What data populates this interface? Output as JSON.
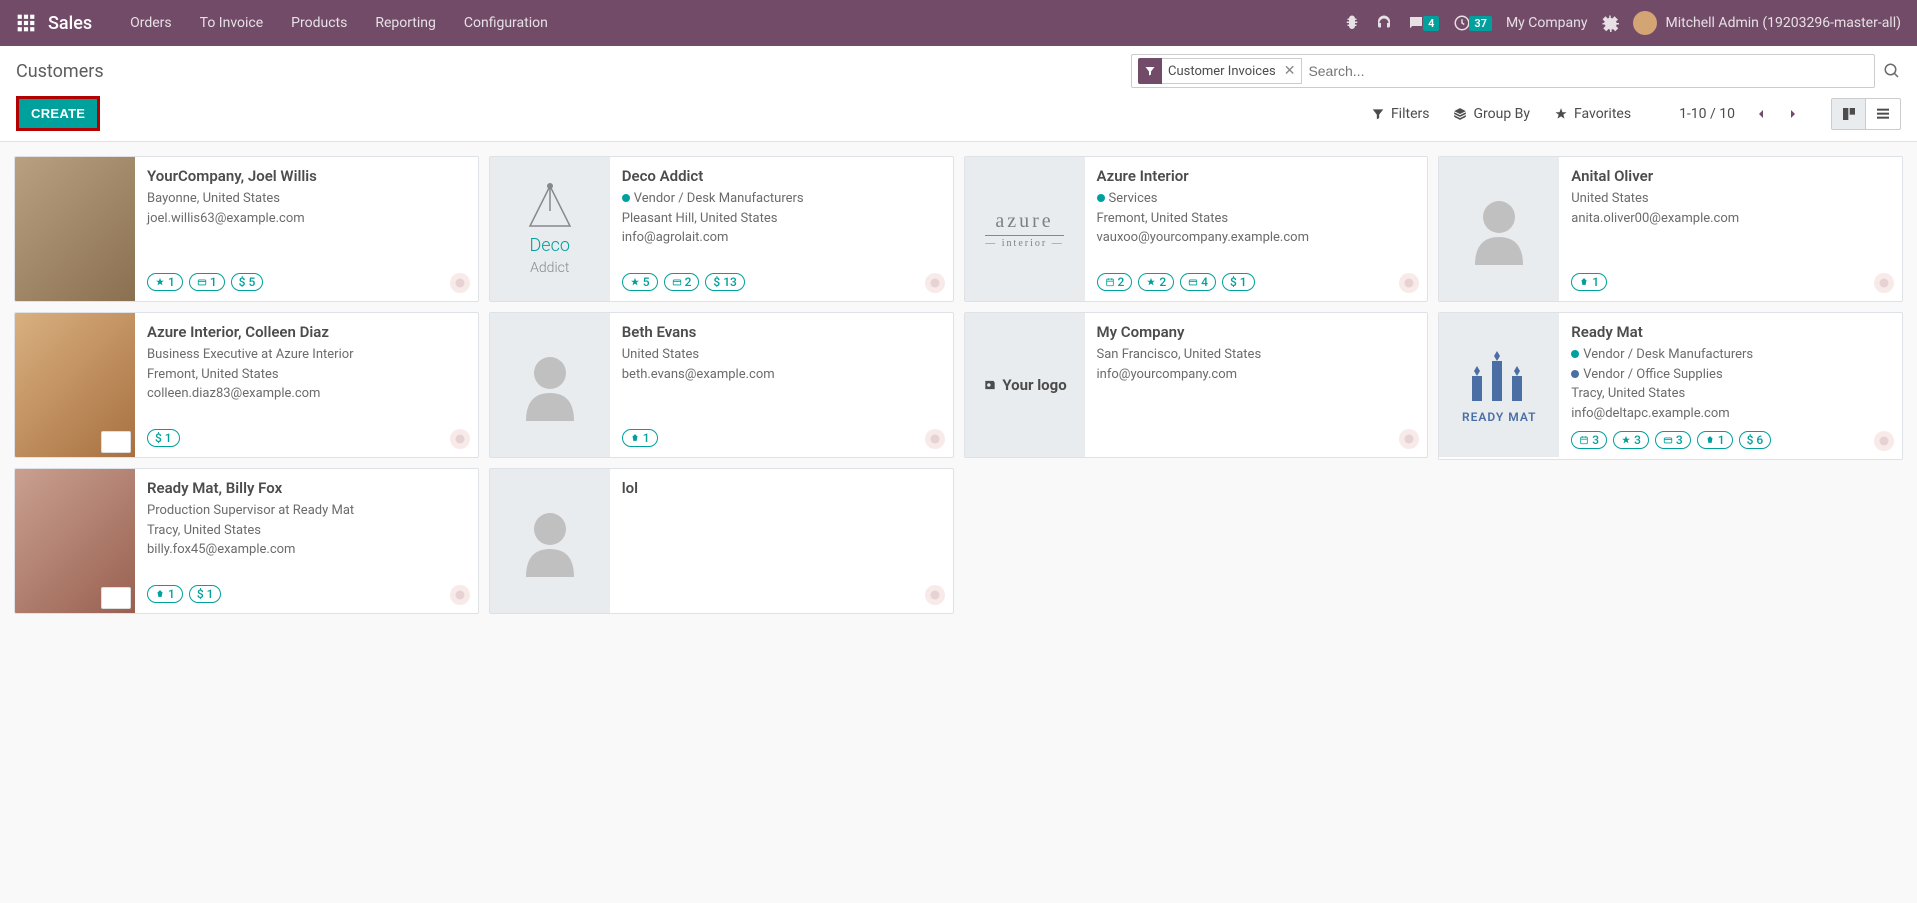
{
  "navbar": {
    "brand": "Sales",
    "links": [
      "Orders",
      "To Invoice",
      "Products",
      "Reporting",
      "Configuration"
    ],
    "messages_badge": "4",
    "activities_badge": "37",
    "company": "My Company",
    "user": "Mitchell Admin (19203296-master-all)"
  },
  "breadcrumb": "Customers",
  "create_label": "CREATE",
  "search": {
    "facet": "Customer Invoices",
    "placeholder": "Search..."
  },
  "toolbar": {
    "filters": "Filters",
    "groupby": "Group By",
    "favorites": "Favorites",
    "pager": "1-10 / 10"
  },
  "cards": {
    "c1": {
      "title": "YourCompany, Joel Willis",
      "l1": "Bayonne, United States",
      "l2": "joel.willis63@example.com",
      "p1": "1",
      "p2": "1",
      "p3": "$ 5"
    },
    "c2": {
      "title": "Deco Addict",
      "tag": "Vendor / Desk Manufacturers",
      "l1": "Pleasant Hill, United States",
      "l2": "info@agrolait.com",
      "p1": "5",
      "p2": "2",
      "p3": "$ 13"
    },
    "c3": {
      "title": "Azure Interior",
      "tag": "Services",
      "l1": "Fremont, United States",
      "l2": "vauxoo@yourcompany.example.com",
      "p1": "2",
      "p2": "2",
      "p3": "4",
      "p4": "$ 1"
    },
    "c4": {
      "title": "Anital Oliver",
      "l1": "United States",
      "l2": "anita.oliver00@example.com",
      "p1": "1"
    },
    "c5": {
      "title": "Azure Interior, Colleen Diaz",
      "sub": "Business Executive at Azure Interior",
      "l1": "Fremont, United States",
      "l2": "colleen.diaz83@example.com",
      "p1": "$ 1"
    },
    "c6": {
      "title": "Beth Evans",
      "l1": "United States",
      "l2": "beth.evans@example.com",
      "p1": "1"
    },
    "c7": {
      "title": "My Company",
      "l1": "San Francisco, United States",
      "l2": "info@yourcompany.com"
    },
    "c8": {
      "title": "Ready Mat",
      "tag1": "Vendor / Desk Manufacturers",
      "tag2": "Vendor / Office Supplies",
      "l1": "Tracy, United States",
      "l2": "info@deltapc.example.com",
      "p1": "3",
      "p2": "3",
      "p3": "3",
      "p4": "1",
      "p5": "$ 6"
    },
    "c9": {
      "title": "Ready Mat, Billy Fox",
      "sub": "Production Supervisor at Ready Mat",
      "l1": "Tracy, United States",
      "l2": "billy.fox45@example.com",
      "p1": "1",
      "p2": "$ 1"
    },
    "c10": {
      "title": "lol"
    }
  },
  "logos": {
    "deco1": "Deco",
    "deco2": "Addict",
    "azure1": "azure",
    "azure2": "interior",
    "your": "Your logo",
    "ready": "READY MAT"
  }
}
